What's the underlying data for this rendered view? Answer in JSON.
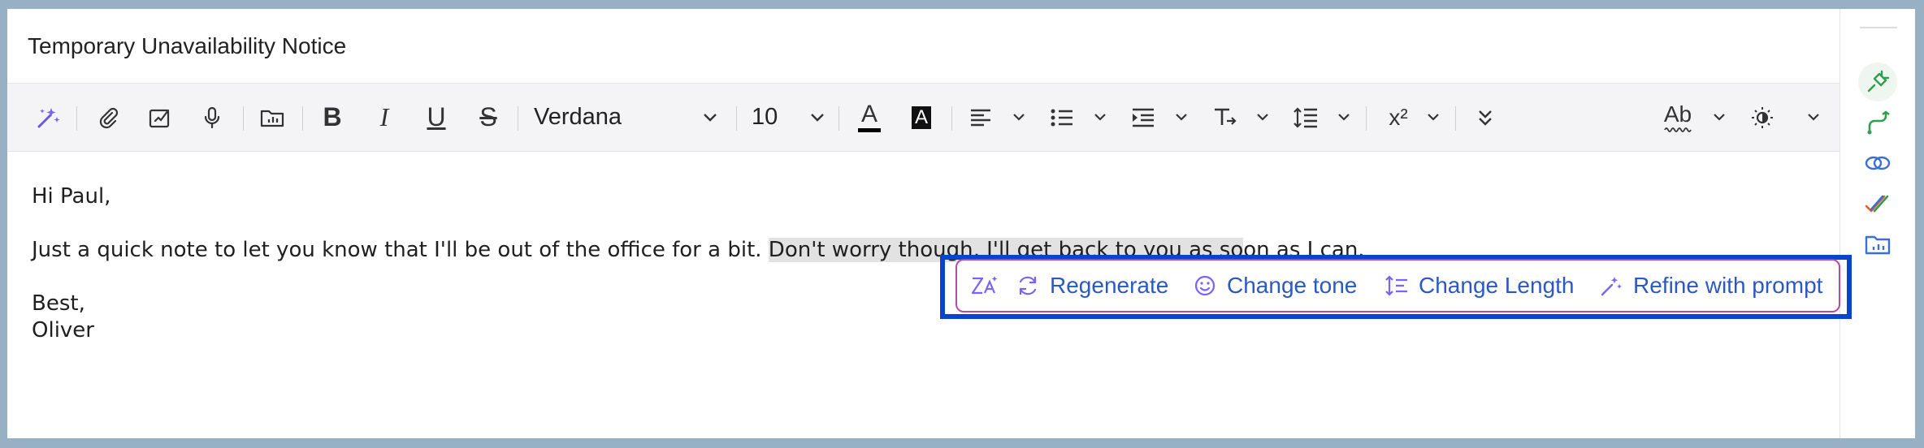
{
  "subject": "Temporary Unavailability Notice",
  "toolbar": {
    "font_name": "Verdana",
    "font_size": "10",
    "bold_label": "B",
    "italic_label": "I",
    "underline_label": "U",
    "strike_label": "S",
    "text_color_label": "A",
    "bg_color_label": "A",
    "superscript_label": "x²",
    "spellcheck_label": "Ab",
    "icons": [
      "ai-sparkle-icon",
      "attachment-icon",
      "signature-icon",
      "microphone-icon",
      "insert-folder-icon",
      "align-left-icon",
      "bulleted-list-icon",
      "indent-icon",
      "clear-format-icon",
      "line-spacing-icon",
      "more-options-icon",
      "theme-icon"
    ]
  },
  "body": {
    "greeting": "Hi Paul,",
    "line_plain": "Just a quick note to let you know that I'll be out of the office for a bit. ",
    "line_selected": "Don't worry though, I'll get back to you as so",
    "line_rest": "on as I can.",
    "closing": "Best,",
    "signature": "Oliver"
  },
  "ai_toolbar": {
    "regenerate": "Regenerate",
    "change_tone": "Change tone",
    "change_length": "Change Length",
    "refine": "Refine with prompt",
    "accent": "#2b59c3",
    "frame_color": "#0a44cc"
  },
  "rail": {
    "icons": [
      "plug-icon",
      "route-icon",
      "link-icon",
      "tasks-check-icon",
      "folder-chart-icon"
    ]
  }
}
